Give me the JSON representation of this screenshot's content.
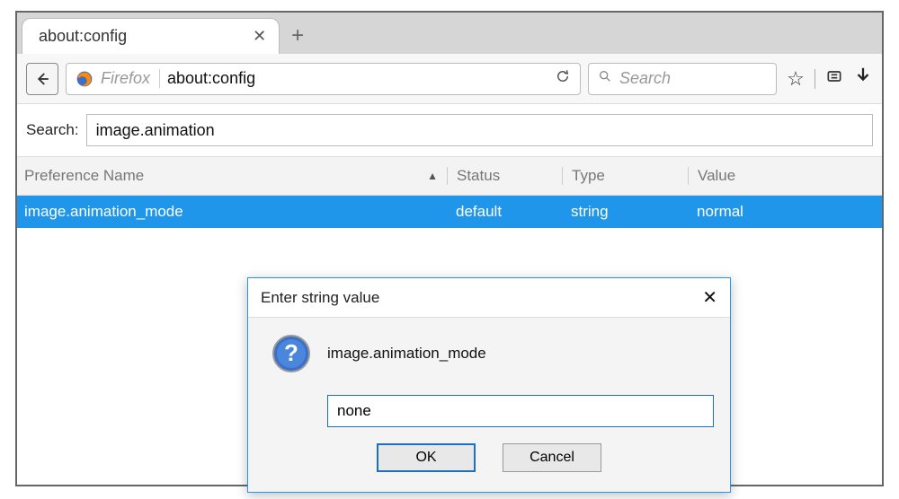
{
  "tab": {
    "title": "about:config"
  },
  "urlbar": {
    "brand": "Firefox",
    "url": "about:config"
  },
  "search_toolbar": {
    "placeholder": "Search"
  },
  "config": {
    "search_label": "Search:",
    "search_value": "image.animation",
    "columns": {
      "pref": "Preference Name",
      "status": "Status",
      "type": "Type",
      "value": "Value"
    },
    "rows": [
      {
        "name": "image.animation_mode",
        "status": "default",
        "type": "string",
        "value": "normal"
      }
    ]
  },
  "dialog": {
    "title": "Enter string value",
    "pref_name": "image.animation_mode",
    "input_value": "none",
    "ok": "OK",
    "cancel": "Cancel"
  }
}
